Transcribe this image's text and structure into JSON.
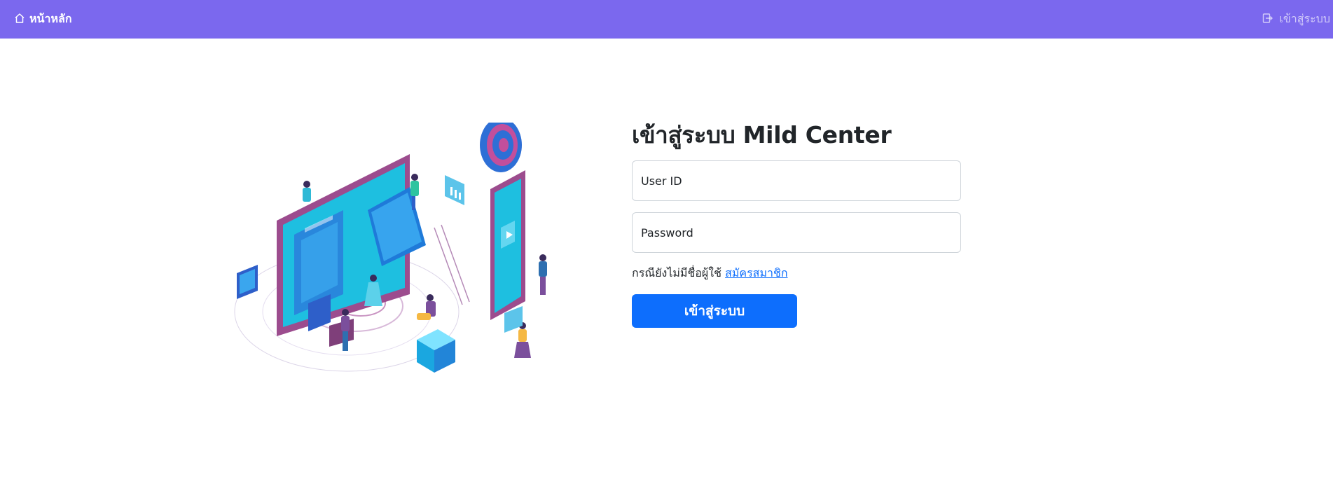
{
  "navbar": {
    "home_label": "หน้าหลัก",
    "home_icon": "home-icon",
    "login_label": "เข้าสู่ระบบ",
    "login_icon": "login-icon",
    "background_color": "#7b68ee"
  },
  "login": {
    "title": "เข้าสู่ระบบ Mild Center",
    "userid_placeholder": "User ID",
    "password_placeholder": "Password",
    "signup_prompt": "กรณียังไม่มีชื่อผู้ใช้",
    "signup_link": "สมัครสมาชิก",
    "submit_label": "เข้าสู่ระบบ",
    "button_color": "#0d6efd",
    "link_color": "#0d6efd"
  },
  "illustration": {
    "icon": "isometric-web-design-team-illustration"
  }
}
